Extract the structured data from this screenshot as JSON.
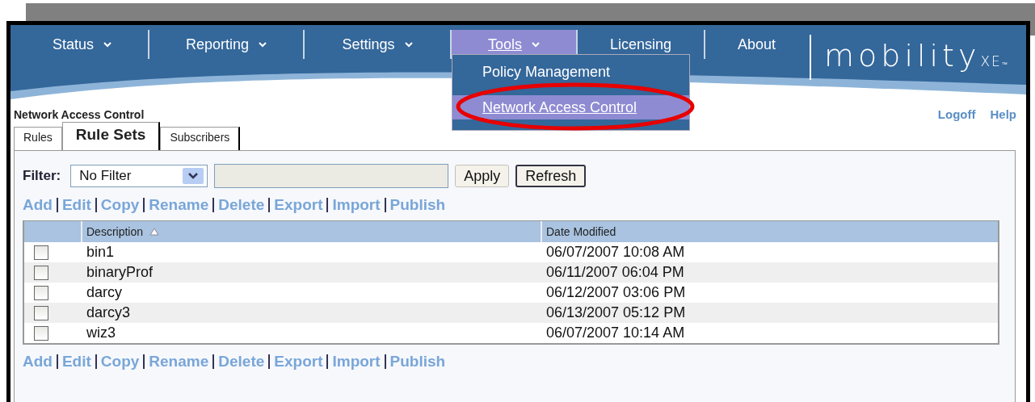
{
  "nav": [
    {
      "label": "Status",
      "caret": true,
      "selected": false
    },
    {
      "label": "Reporting",
      "caret": true,
      "selected": false
    },
    {
      "label": "Settings",
      "caret": true,
      "selected": false
    },
    {
      "label": "Tools",
      "caret": true,
      "selected": true
    },
    {
      "label": "Licensing",
      "caret": false,
      "selected": false
    },
    {
      "label": "About",
      "caret": false,
      "selected": false
    }
  ],
  "logo": {
    "word": "mobility",
    "suffix": "XE",
    "tm": "™"
  },
  "tools_menu": [
    {
      "label": "Policy Management",
      "selected": false
    },
    {
      "label": "Network Access Control",
      "selected": true
    }
  ],
  "page_title": "Network Access Control",
  "header_links": [
    "Logoff",
    "Help"
  ],
  "tabs": [
    {
      "label": "Rules",
      "selected": false
    },
    {
      "label": "Rule Sets",
      "selected": true
    },
    {
      "label": "Subscribers",
      "selected": false
    }
  ],
  "filter": {
    "label": "Filter:",
    "value": "No Filter",
    "buttons": [
      "Apply",
      "Refresh"
    ]
  },
  "actions_top": [
    "Add",
    "Edit",
    "Copy",
    "Rename",
    "Delete",
    "Export",
    "Import",
    "Publish"
  ],
  "table": {
    "columns": [
      {
        "label": "Description",
        "sorted": true
      },
      {
        "label": "Date Modified",
        "sorted": false
      }
    ],
    "rows": [
      {
        "checked": false,
        "description": "bin1",
        "date": "06/07/2007 10:08 AM"
      },
      {
        "checked": false,
        "description": "binaryProf",
        "date": "06/11/2007 06:04 PM"
      },
      {
        "checked": false,
        "description": "darcy",
        "date": "06/12/2007 03:06 PM"
      },
      {
        "checked": false,
        "description": "darcy3",
        "date": "06/13/2007 05:12 PM"
      },
      {
        "checked": false,
        "description": "wiz3",
        "date": "06/07/2007 10:14 AM"
      }
    ]
  },
  "actions_bottom": [
    "Add",
    "Edit",
    "Copy",
    "Rename",
    "Delete",
    "Export",
    "Import",
    "Publish"
  ],
  "annotation": {
    "kind": "ellipse"
  }
}
